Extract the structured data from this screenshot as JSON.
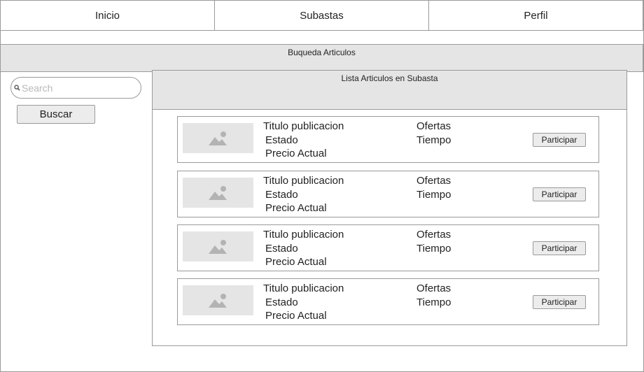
{
  "nav": {
    "tabs": [
      {
        "label": "Inicio"
      },
      {
        "label": "Subastas"
      },
      {
        "label": "Perfil"
      }
    ]
  },
  "search_section": {
    "title": "Buqueda Articulos",
    "search_placeholder": "Search",
    "search_value": "",
    "button_label": "Buscar"
  },
  "list": {
    "title": "Lista Articulos en Subasta",
    "items": [
      {
        "image_icon": "image-placeholder-icon",
        "title": "Titulo publicacion",
        "estado": "Estado",
        "precio": "Precio Actual",
        "ofertas": "Ofertas",
        "tiempo": "Tiempo",
        "button_label": "Participar"
      },
      {
        "image_icon": "image-placeholder-icon",
        "title": "Titulo publicacion",
        "estado": "Estado",
        "precio": "Precio Actual",
        "ofertas": "Ofertas",
        "tiempo": "Tiempo",
        "button_label": "Participar"
      },
      {
        "image_icon": "image-placeholder-icon",
        "title": "Titulo publicacion",
        "estado": "Estado",
        "precio": "Precio Actual",
        "ofertas": "Ofertas",
        "tiempo": "Tiempo",
        "button_label": "Participar"
      },
      {
        "image_icon": "image-placeholder-icon",
        "title": "Titulo publicacion",
        "estado": "Estado",
        "precio": "Precio Actual",
        "ofertas": "Ofertas",
        "tiempo": "Tiempo",
        "button_label": "Participar"
      }
    ]
  },
  "colors": {
    "border": "#9a9a9a",
    "panel_fill": "#e5e5e5",
    "button_fill": "#ececec",
    "placeholder_icon": "#b3b3b3"
  }
}
